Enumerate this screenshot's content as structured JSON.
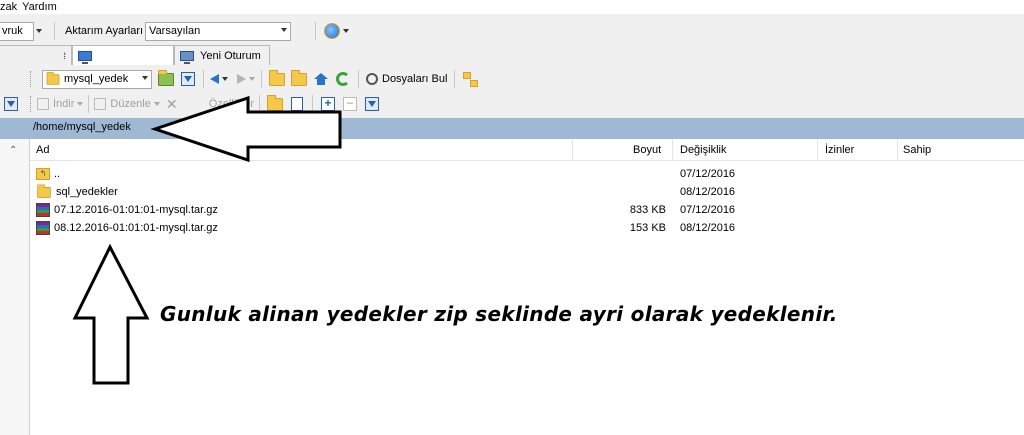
{
  "menu": {
    "items": [
      "zak",
      "Yardım"
    ]
  },
  "toolbar1": {
    "left_combo": "vruk",
    "transfer_label": "Aktarım Ayarları",
    "transfer_value": "Varsayılan",
    "globe_icon": "globe-icon"
  },
  "tabs": {
    "session_label": "",
    "new_session_label": "Yeni Oturum"
  },
  "toolbar2": {
    "folder_combo": "mysql_yedek",
    "find_files_label": "Dosyaları Bul"
  },
  "toolbar3": {
    "download_label": "İndir",
    "edit_label": "Düzenle",
    "properties_label": "Özellikler"
  },
  "path": "/home/mysql_yedek",
  "columns": {
    "name": "Ad",
    "size": "Boyut",
    "modified": "Değişiklik",
    "permissions": "İzinler",
    "owner": "Sahip"
  },
  "files": [
    {
      "name": "..",
      "size": "",
      "date": "07/12/2016",
      "icon": "parent-folder-icon"
    },
    {
      "name": "sql_yedekler",
      "size": "",
      "date": "08/12/2016",
      "icon": "folder-icon"
    },
    {
      "name": "07.12.2016-01:01:01-mysql.tar.gz",
      "size": "833 KB",
      "date": "07/12/2016",
      "icon": "archive-icon"
    },
    {
      "name": "08.12.2016-01:01:01-mysql.tar.gz",
      "size": "153 KB",
      "date": "08/12/2016",
      "icon": "archive-icon"
    }
  ],
  "annotation": "Gunluk alinan yedekler zip seklinde ayri olarak yedeklenir."
}
